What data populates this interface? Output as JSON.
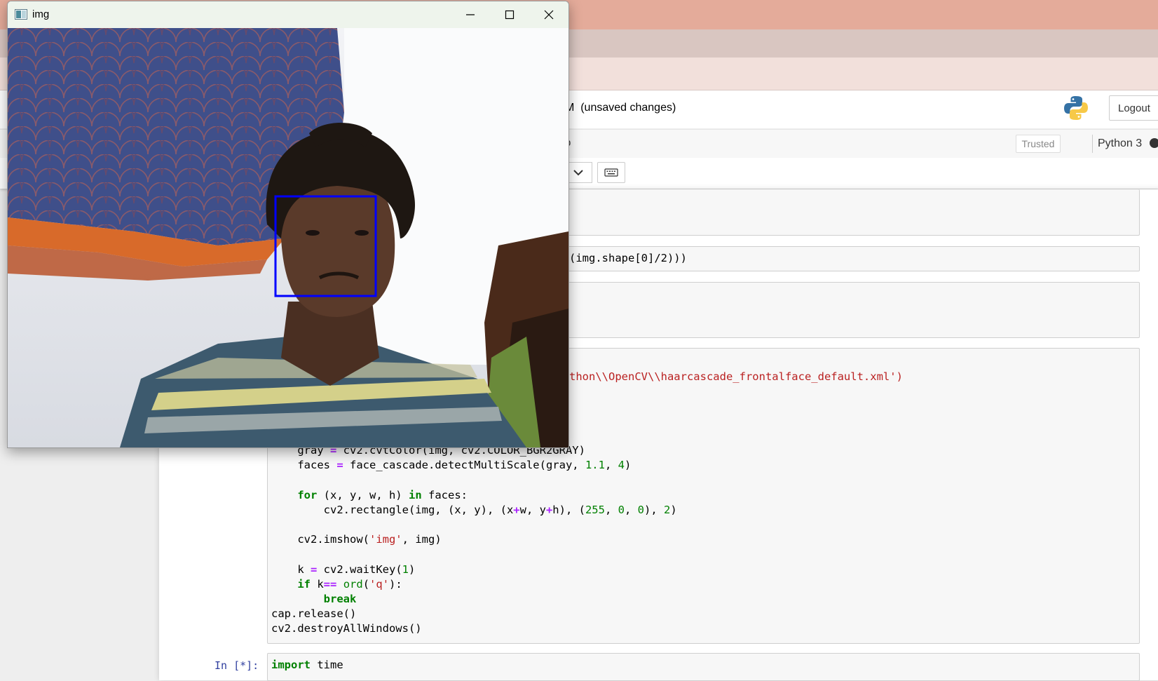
{
  "window": {
    "title": "img",
    "controls": {
      "minimize": "minimize-icon",
      "maximize": "maximize-icon",
      "close": "close-icon"
    },
    "face_box_color": "#0000ff"
  },
  "notebook": {
    "title_fragment": "M",
    "status": "(unsaved changes)",
    "logout_label": "Logout",
    "menu_fragment": "p",
    "trusted_label": "Trusted",
    "kernel_name": "Python 3"
  },
  "cells": {
    "shape_line": "(img.shape[0]/2)))",
    "cascade_line": "thon\\\\OpenCV\\\\haarcascade_frontalface_default.xml')",
    "code_lines": [
      "    gray = cv2.cvtColor(img, cv2.COLOR_BGR2GRAY)",
      "    faces = face_cascade.detectMultiScale(gray, 1.1, 4)",
      "",
      "    for (x, y, w, h) in faces:",
      "        cv2.rectangle(img, (x, y), (x+w, y+h), (255, 0, 0), 2)",
      "",
      "    cv2.imshow('img', img)",
      "",
      "    k = cv2.waitKey(1)",
      "    if k== ord('q'):",
      "        break",
      "cap.release()",
      "cv2.destroyAllWindows()"
    ],
    "next_prompt": "In [*]:",
    "next_code": "import time"
  },
  "colors": {
    "keyword": "#008000",
    "operator": "#aa22ff",
    "string": "#ba2121",
    "number": "#008000",
    "prompt": "#303f9f"
  }
}
